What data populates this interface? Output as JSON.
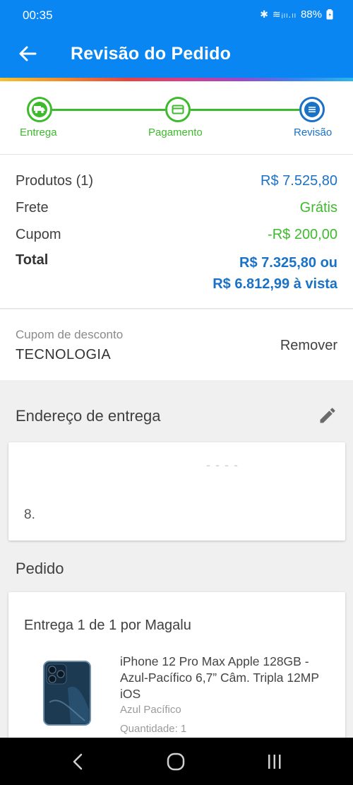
{
  "status_bar": {
    "time": "00:35",
    "icons": "✱ ≋ᵢₗₗ.ₗₗ",
    "battery": "88%"
  },
  "header": {
    "title": "Revisão do Pedido"
  },
  "stepper": {
    "steps": [
      {
        "label": "Entrega",
        "state": "done",
        "icon": "truck-icon"
      },
      {
        "label": "Pagamento",
        "state": "done",
        "icon": "card-icon"
      },
      {
        "label": "Revisão",
        "state": "current",
        "icon": "list-icon"
      }
    ]
  },
  "summary": {
    "products_label": "Produtos (1)",
    "products_value": "R$ 7.525,80",
    "shipping_label": "Frete",
    "shipping_value": "Grátis",
    "coupon_label": "Cupom",
    "coupon_value": "-R$ 200,00",
    "total_label": "Total",
    "total_value_line1": "R$ 7.325,80 ou",
    "total_value_line2": "R$ 6.812,99 à vista"
  },
  "coupon": {
    "label": "Cupom de desconto",
    "code": "TECNOLOGIA",
    "remove_label": "Remover"
  },
  "address": {
    "title": "Endereço de entrega",
    "line2_fragment": "- - -  -",
    "line3_fragment": "8."
  },
  "order": {
    "title": "Pedido",
    "delivery_title": "Entrega 1 de 1 por Magalu",
    "product_name": "iPhone 12 Pro Max Apple 128GB - Azul-Pacífico 6,7” Câm. Tripla 12MP iOS",
    "product_color": "Azul Pacífico",
    "product_qty": "Quantidade:  1"
  },
  "colors": {
    "primary": "#0a86f2",
    "accent_blue": "#1a72c7",
    "success_green": "#3dbb2c"
  }
}
